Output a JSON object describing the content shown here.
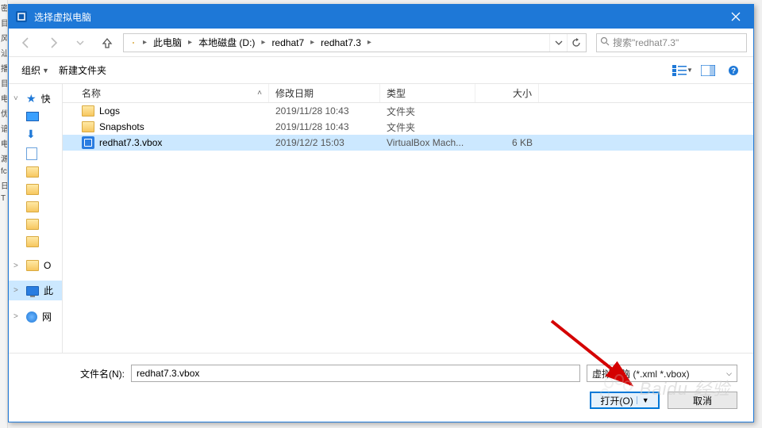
{
  "title": "选择虚拟电脑",
  "breadcrumb": [
    "此电脑",
    "本地磁盘 (D:)",
    "redhat7",
    "redhat7.3"
  ],
  "search_placeholder": "搜索\"redhat7.3\"",
  "toolbar": {
    "organize": "组织",
    "new_folder": "新建文件夹"
  },
  "columns": {
    "name": "名称",
    "date": "修改日期",
    "type": "类型",
    "size": "大小"
  },
  "files": [
    {
      "name": "Logs",
      "date": "2019/11/28 10:43",
      "type": "文件夹",
      "size": "",
      "kind": "folder"
    },
    {
      "name": "Snapshots",
      "date": "2019/11/28 10:43",
      "type": "文件夹",
      "size": "",
      "kind": "folder"
    },
    {
      "name": "redhat7.3.vbox",
      "date": "2019/12/2 15:03",
      "type": "VirtualBox Mach...",
      "size": "6 KB",
      "kind": "vbox",
      "selected": true
    }
  ],
  "sidebar": [
    {
      "label": "快",
      "icon": "star",
      "exp": true
    },
    {
      "label": "",
      "icon": "desktop"
    },
    {
      "label": "",
      "icon": "download"
    },
    {
      "label": "",
      "icon": "doc"
    },
    {
      "label": "",
      "icon": "folder"
    },
    {
      "label": "",
      "icon": "folder"
    },
    {
      "label": "",
      "icon": "folder"
    },
    {
      "label": "",
      "icon": "folder"
    },
    {
      "label": "",
      "icon": "folder"
    },
    {
      "label": "O",
      "icon": "folder"
    },
    {
      "label": "此",
      "icon": "pc",
      "exp": true
    },
    {
      "label": "网",
      "icon": "globe",
      "exp": true
    }
  ],
  "footer": {
    "filename_label": "文件名(N):",
    "filename_value": "redhat7.3.vbox",
    "filter_label": "虚拟电脑 (*.xml *.vbox)",
    "open": "打开(O)",
    "cancel": "取消"
  },
  "watermark": "Baidu 经验"
}
